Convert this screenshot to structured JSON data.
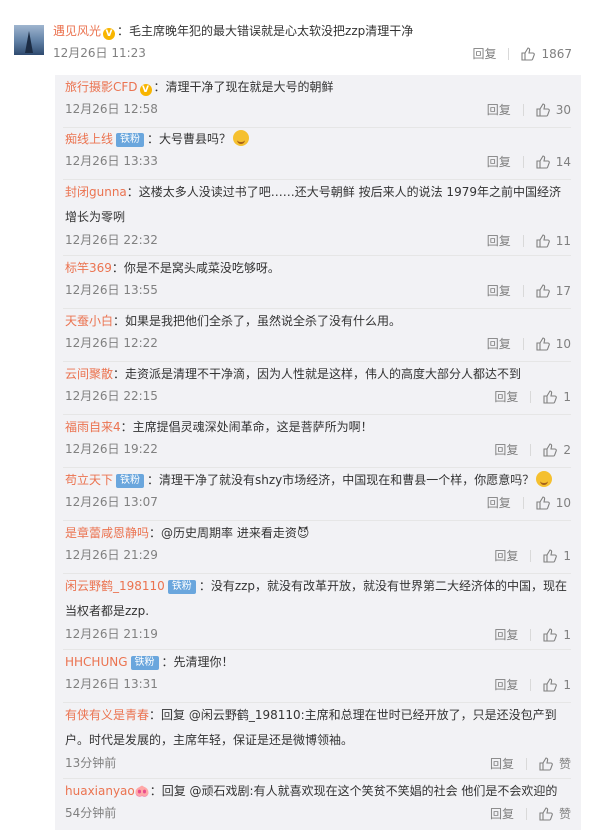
{
  "main_comment": {
    "user": "遇见风光",
    "text": "：毛主席晚年犯的最大错误就是心太软没把zzp清理干净",
    "time": "12月26日 11:23",
    "reply_label": "回复",
    "likes": "1867"
  },
  "replies": [
    {
      "user": "旅行摄影CFD",
      "vip": true,
      "fan": "",
      "lines": [
        "：清理干净了现在就是大号的朝鲜"
      ],
      "time": "12月26日 12:58",
      "likes": "30"
    },
    {
      "user": "痴线上线",
      "vip": false,
      "fan": "铁粉",
      "lines": [
        "：大号曹县吗？"
      ],
      "emoji": true,
      "time": "12月26日 13:33",
      "likes": "14"
    },
    {
      "user": "封闭gunna",
      "vip": false,
      "fan": "",
      "lines": [
        "：这楼太多人没读过书了吧……还大号朝鲜 按后来人的说法 1979年之前中国经济",
        "增长为零咧"
      ],
      "time": "12月26日 22:32",
      "likes": "11"
    },
    {
      "user": "标竿369",
      "vip": false,
      "fan": "",
      "lines": [
        "：你是不是窝头咸菜没吃够呀。"
      ],
      "time": "12月26日 13:55",
      "likes": "17"
    },
    {
      "user": "天蚕小白",
      "vip": false,
      "fan": "",
      "lines": [
        "：如果是我把他们全杀了，虽然说全杀了没有什么用。"
      ],
      "time": "12月26日 12:22",
      "likes": "10"
    },
    {
      "user": "云间聚散",
      "vip": false,
      "fan": "",
      "lines": [
        "：走资派是清理不干净滴，因为人性就是这样，伟人的高度大部分人都达不到"
      ],
      "time": "12月26日 22:15",
      "likes": "1"
    },
    {
      "user": "福雨自来4",
      "vip": false,
      "fan": "",
      "lines": [
        "：主席提倡灵魂深处闹革命，这是菩萨所为啊！"
      ],
      "time": "12月26日 19:22",
      "likes": "2"
    },
    {
      "user": "苟立天下",
      "vip": false,
      "fan": "铁粉",
      "lines": [
        "：清理干净了就没有shzy市场经济，中国现在和曹县一个样，你愿意吗？"
      ],
      "emoji": true,
      "time": "12月26日 13:07",
      "likes": "10"
    },
    {
      "user": "是章蕾咸恩静吗",
      "vip": false,
      "fan": "",
      "lines": [
        "：@历史周期率 进来看走资😈"
      ],
      "time": "12月26日 21:29",
      "likes": "1"
    },
    {
      "user": "闲云野鹤_198110",
      "vip": false,
      "fan": "铁粉",
      "lines": [
        "：没有zzp，就没有改革开放，就没有世界第二大经济体的中国，现在",
        "当权者都是zzp."
      ],
      "time": "12月26日 21:19",
      "likes": "1"
    },
    {
      "user": "HHCHUNG",
      "vip": false,
      "fan": "铁粉",
      "lines": [
        "：先清理你！"
      ],
      "time": "12月26日 13:31",
      "likes": "1"
    },
    {
      "user": "有侠有义是青春",
      "vip": false,
      "fan": "",
      "lines": [
        "：回复 @闲云野鹤_198110:主席和总理在世时已经开放了，只是还没包产到",
        "户。时代是发展的，主席年轻，保证是还是微博领袖。"
      ],
      "time": "13分钟前",
      "likes": "赞"
    },
    {
      "user": "huaxianyao",
      "vip": false,
      "fan": "",
      "lines": [
        "🐽：回复 @顽石戏剧:有人就喜欢现在这个笑贫不笑娼的社会  他们是不会欢迎的"
      ],
      "time": "54分钟前",
      "likes": "赞"
    }
  ],
  "colors": {
    "username": "#eb7350",
    "meta": "#808080",
    "reply_bg": "#f2f2f5",
    "fan_badge": "#6aa6dd",
    "vip_badge": "#f8b500"
  },
  "icons": {
    "like": "thumbs-up-icon",
    "vip": "v-badge-icon",
    "emoji": "laughing-emoji-icon"
  }
}
